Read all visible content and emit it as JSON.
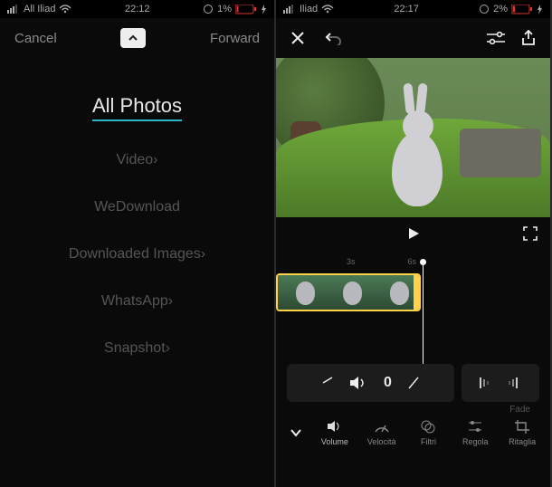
{
  "left": {
    "status": {
      "carrier": "All Iliad",
      "time": "22:12",
      "battery": "1%"
    },
    "nav": {
      "cancel": "Cancel",
      "forward": "Forward"
    },
    "albums": [
      {
        "label": "All Photos",
        "active": true
      },
      {
        "label": "Video›",
        "active": false
      },
      {
        "label": "WeDownload",
        "active": false
      },
      {
        "label": "Downloaded Images›",
        "active": false
      },
      {
        "label": "WhatsApp›",
        "active": false
      },
      {
        "label": "Snapshot›",
        "active": false
      }
    ]
  },
  "right": {
    "status": {
      "carrier": "Iliad",
      "time": "22:17",
      "battery": "2%"
    },
    "timeline": {
      "ticks": [
        "3s",
        "6s"
      ]
    },
    "volume": {
      "value": "0"
    },
    "fade_label": "Fade",
    "tools": [
      {
        "label": "Volume"
      },
      {
        "label": "Velocità"
      },
      {
        "label": "Filtri"
      },
      {
        "label": "Regola"
      },
      {
        "label": "Ritaglia"
      }
    ]
  }
}
